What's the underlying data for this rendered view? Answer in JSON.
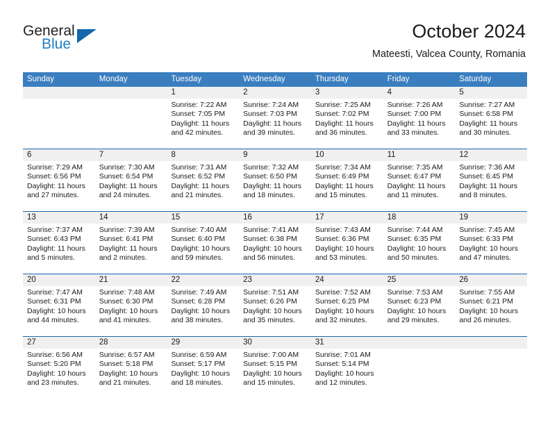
{
  "logo": {
    "word_one": "General",
    "word_two": "Blue",
    "triangle": "triangle-mark"
  },
  "header": {
    "title": "October 2024",
    "subtitle": "Mateesti, Valcea County, Romania"
  },
  "colors": {
    "header_blue": "#3a7ebf",
    "week_divider": "#1667ad",
    "date_band": "#f0f0f0",
    "logo_blue": "#1f7fc4",
    "text": "#1a1a1a"
  },
  "weekdays": [
    "Sunday",
    "Monday",
    "Tuesday",
    "Wednesday",
    "Thursday",
    "Friday",
    "Saturday"
  ],
  "labels": {
    "sunrise": "Sunrise:",
    "sunset": "Sunset:",
    "daylight": "Daylight:"
  },
  "weeks": [
    [
      {
        "day": "",
        "lines": []
      },
      {
        "day": "",
        "lines": []
      },
      {
        "day": "1",
        "lines": [
          "Sunrise: 7:22 AM",
          "Sunset: 7:05 PM",
          "Daylight: 11 hours",
          "and 42 minutes."
        ]
      },
      {
        "day": "2",
        "lines": [
          "Sunrise: 7:24 AM",
          "Sunset: 7:03 PM",
          "Daylight: 11 hours",
          "and 39 minutes."
        ]
      },
      {
        "day": "3",
        "lines": [
          "Sunrise: 7:25 AM",
          "Sunset: 7:02 PM",
          "Daylight: 11 hours",
          "and 36 minutes."
        ]
      },
      {
        "day": "4",
        "lines": [
          "Sunrise: 7:26 AM",
          "Sunset: 7:00 PM",
          "Daylight: 11 hours",
          "and 33 minutes."
        ]
      },
      {
        "day": "5",
        "lines": [
          "Sunrise: 7:27 AM",
          "Sunset: 6:58 PM",
          "Daylight: 11 hours",
          "and 30 minutes."
        ]
      }
    ],
    [
      {
        "day": "6",
        "lines": [
          "Sunrise: 7:29 AM",
          "Sunset: 6:56 PM",
          "Daylight: 11 hours",
          "and 27 minutes."
        ]
      },
      {
        "day": "7",
        "lines": [
          "Sunrise: 7:30 AM",
          "Sunset: 6:54 PM",
          "Daylight: 11 hours",
          "and 24 minutes."
        ]
      },
      {
        "day": "8",
        "lines": [
          "Sunrise: 7:31 AM",
          "Sunset: 6:52 PM",
          "Daylight: 11 hours",
          "and 21 minutes."
        ]
      },
      {
        "day": "9",
        "lines": [
          "Sunrise: 7:32 AM",
          "Sunset: 6:50 PM",
          "Daylight: 11 hours",
          "and 18 minutes."
        ]
      },
      {
        "day": "10",
        "lines": [
          "Sunrise: 7:34 AM",
          "Sunset: 6:49 PM",
          "Daylight: 11 hours",
          "and 15 minutes."
        ]
      },
      {
        "day": "11",
        "lines": [
          "Sunrise: 7:35 AM",
          "Sunset: 6:47 PM",
          "Daylight: 11 hours",
          "and 11 minutes."
        ]
      },
      {
        "day": "12",
        "lines": [
          "Sunrise: 7:36 AM",
          "Sunset: 6:45 PM",
          "Daylight: 11 hours",
          "and 8 minutes."
        ]
      }
    ],
    [
      {
        "day": "13",
        "lines": [
          "Sunrise: 7:37 AM",
          "Sunset: 6:43 PM",
          "Daylight: 11 hours",
          "and 5 minutes."
        ]
      },
      {
        "day": "14",
        "lines": [
          "Sunrise: 7:39 AM",
          "Sunset: 6:41 PM",
          "Daylight: 11 hours",
          "and 2 minutes."
        ]
      },
      {
        "day": "15",
        "lines": [
          "Sunrise: 7:40 AM",
          "Sunset: 6:40 PM",
          "Daylight: 10 hours",
          "and 59 minutes."
        ]
      },
      {
        "day": "16",
        "lines": [
          "Sunrise: 7:41 AM",
          "Sunset: 6:38 PM",
          "Daylight: 10 hours",
          "and 56 minutes."
        ]
      },
      {
        "day": "17",
        "lines": [
          "Sunrise: 7:43 AM",
          "Sunset: 6:36 PM",
          "Daylight: 10 hours",
          "and 53 minutes."
        ]
      },
      {
        "day": "18",
        "lines": [
          "Sunrise: 7:44 AM",
          "Sunset: 6:35 PM",
          "Daylight: 10 hours",
          "and 50 minutes."
        ]
      },
      {
        "day": "19",
        "lines": [
          "Sunrise: 7:45 AM",
          "Sunset: 6:33 PM",
          "Daylight: 10 hours",
          "and 47 minutes."
        ]
      }
    ],
    [
      {
        "day": "20",
        "lines": [
          "Sunrise: 7:47 AM",
          "Sunset: 6:31 PM",
          "Daylight: 10 hours",
          "and 44 minutes."
        ]
      },
      {
        "day": "21",
        "lines": [
          "Sunrise: 7:48 AM",
          "Sunset: 6:30 PM",
          "Daylight: 10 hours",
          "and 41 minutes."
        ]
      },
      {
        "day": "22",
        "lines": [
          "Sunrise: 7:49 AM",
          "Sunset: 6:28 PM",
          "Daylight: 10 hours",
          "and 38 minutes."
        ]
      },
      {
        "day": "23",
        "lines": [
          "Sunrise: 7:51 AM",
          "Sunset: 6:26 PM",
          "Daylight: 10 hours",
          "and 35 minutes."
        ]
      },
      {
        "day": "24",
        "lines": [
          "Sunrise: 7:52 AM",
          "Sunset: 6:25 PM",
          "Daylight: 10 hours",
          "and 32 minutes."
        ]
      },
      {
        "day": "25",
        "lines": [
          "Sunrise: 7:53 AM",
          "Sunset: 6:23 PM",
          "Daylight: 10 hours",
          "and 29 minutes."
        ]
      },
      {
        "day": "26",
        "lines": [
          "Sunrise: 7:55 AM",
          "Sunset: 6:21 PM",
          "Daylight: 10 hours",
          "and 26 minutes."
        ]
      }
    ],
    [
      {
        "day": "27",
        "lines": [
          "Sunrise: 6:56 AM",
          "Sunset: 5:20 PM",
          "Daylight: 10 hours",
          "and 23 minutes."
        ]
      },
      {
        "day": "28",
        "lines": [
          "Sunrise: 6:57 AM",
          "Sunset: 5:18 PM",
          "Daylight: 10 hours",
          "and 21 minutes."
        ]
      },
      {
        "day": "29",
        "lines": [
          "Sunrise: 6:59 AM",
          "Sunset: 5:17 PM",
          "Daylight: 10 hours",
          "and 18 minutes."
        ]
      },
      {
        "day": "30",
        "lines": [
          "Sunrise: 7:00 AM",
          "Sunset: 5:15 PM",
          "Daylight: 10 hours",
          "and 15 minutes."
        ]
      },
      {
        "day": "31",
        "lines": [
          "Sunrise: 7:01 AM",
          "Sunset: 5:14 PM",
          "Daylight: 10 hours",
          "and 12 minutes."
        ]
      },
      {
        "day": "",
        "lines": []
      },
      {
        "day": "",
        "lines": []
      }
    ]
  ]
}
